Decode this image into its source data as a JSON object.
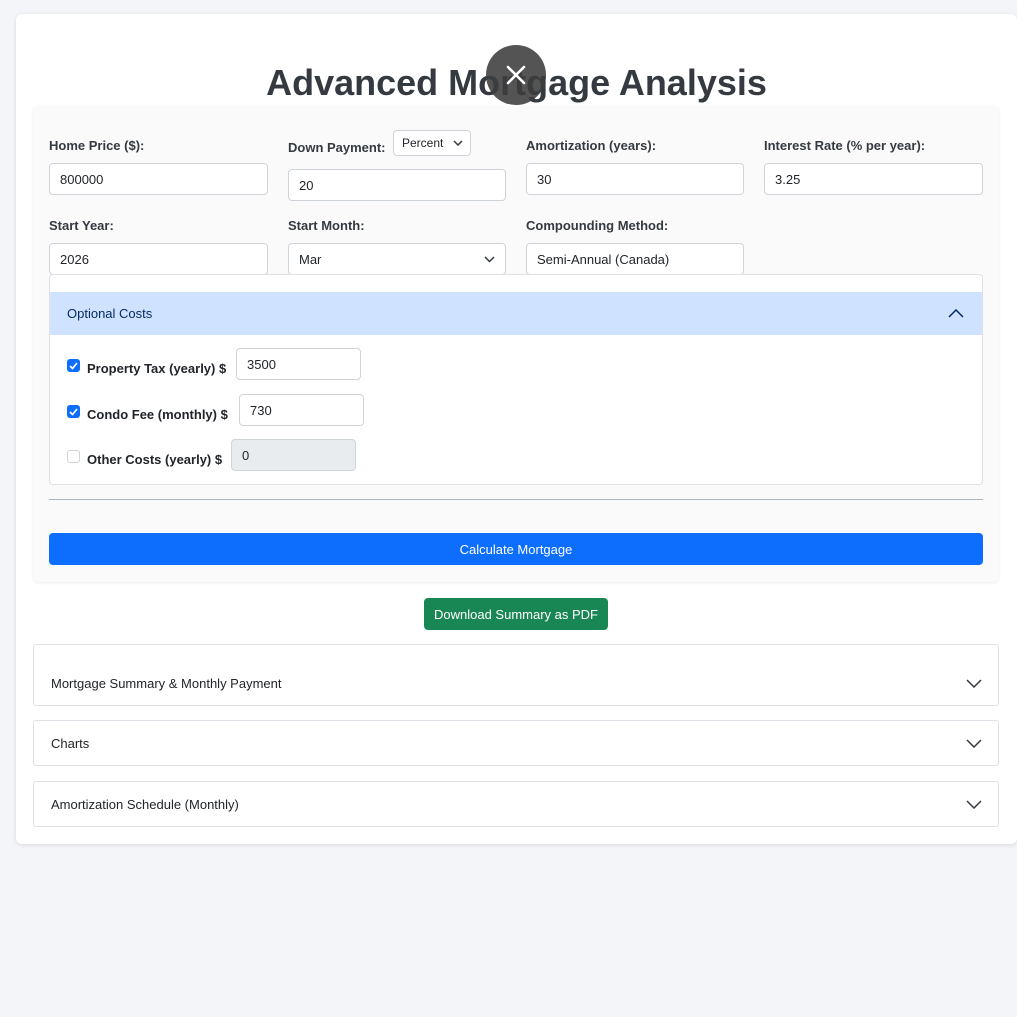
{
  "page": {
    "title": "Advanced Mortgage Analysis"
  },
  "overlay": {
    "close_icon": "close-icon"
  },
  "form": {
    "home_price": {
      "label": "Home Price ($):",
      "value": "800000"
    },
    "down_payment": {
      "label": "Down Payment:",
      "mode": "Percent",
      "value": "20"
    },
    "amortization": {
      "label": "Amortization (years):",
      "value": "30"
    },
    "interest_rate": {
      "label": "Interest Rate (% per year):",
      "value": "3.25"
    },
    "start_year": {
      "label": "Start Year:",
      "value": "2026"
    },
    "start_month": {
      "label": "Start Month:",
      "value": "Mar"
    },
    "compounding": {
      "label": "Compounding Method:",
      "value": "Semi-Annual (Canada)"
    }
  },
  "optional_costs": {
    "header": "Optional Costs",
    "expanded": true,
    "items": [
      {
        "label": "Property Tax (yearly) $",
        "checked": true,
        "value": "3500"
      },
      {
        "label": "Condo Fee (monthly) $",
        "checked": true,
        "value": "730"
      },
      {
        "label": "Other Costs (yearly) $",
        "checked": false,
        "value": "0"
      }
    ]
  },
  "actions": {
    "calculate": "Calculate Mortgage",
    "download_pdf": "Download Summary as PDF"
  },
  "sections": [
    {
      "label": "Mortgage Summary & Monthly Payment",
      "expanded": false
    },
    {
      "label": "Charts",
      "expanded": false
    },
    {
      "label": "Amortization Schedule (Monthly)",
      "expanded": false
    }
  ],
  "colors": {
    "primary": "#0d6efd",
    "success": "#198754",
    "accordion_active_bg": "#cfe2ff",
    "page_bg": "#f4f5f8"
  }
}
